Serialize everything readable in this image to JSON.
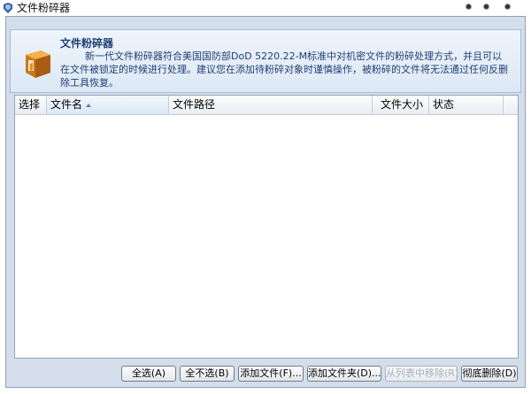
{
  "window": {
    "title": "文件粉碎器",
    "buttons": [
      "minimize-button",
      "maximize-button",
      "close-button"
    ]
  },
  "header": {
    "title": "文件粉碎器",
    "description": "新一代文件粉碎器符合美国国防部DoD 5220.22-M标准中对机密文件的粉碎处理方式，并且可以在文件被锁定的时候进行处理。建议您在添加待粉碎对象时谨慎操作，被粉碎的文件将无法通过任何反删除工具恢复。"
  },
  "table": {
    "columns": [
      {
        "key": "select",
        "label": "选择"
      },
      {
        "key": "filename",
        "label": "文件名",
        "sorted": "asc"
      },
      {
        "key": "path",
        "label": "文件路径"
      },
      {
        "key": "size",
        "label": "文件大小"
      },
      {
        "key": "status",
        "label": "状态"
      }
    ],
    "rows": []
  },
  "actions": {
    "select_all": "全选(A)",
    "select_none": "全不选(B)",
    "add_file": "添加文件(F)...",
    "add_folder": "添加文件夹(D)...",
    "remove_selected": "从列表中移除(R)",
    "shred": "彻底删除(D)"
  },
  "colors": {
    "frame_bg": "#d4deea",
    "header_text": "#1f3f74",
    "accent": "#5a7fb0"
  }
}
